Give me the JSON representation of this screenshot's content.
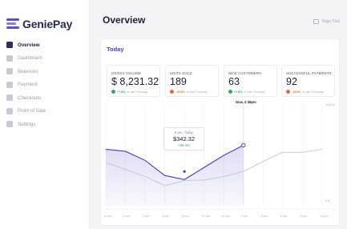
{
  "brand": {
    "name": "GeniePay",
    "accent": "#5d4fc9"
  },
  "sidebar": {
    "items": [
      {
        "label": "Overview",
        "icon": "overview-icon",
        "active": true
      },
      {
        "label": "Dashboard",
        "icon": "dashboard-icon",
        "active": false
      },
      {
        "label": "Balances",
        "icon": "balances-icon",
        "active": false
      },
      {
        "label": "Payment",
        "icon": "payment-icon",
        "active": false
      },
      {
        "label": "Checkouts",
        "icon": "checkouts-icon",
        "active": false
      },
      {
        "label": "Point of Sale",
        "icon": "point-of-sale-icon",
        "active": false
      },
      {
        "label": "Settings",
        "icon": "settings-icon",
        "active": false
      }
    ]
  },
  "header": {
    "title": "Overview",
    "signout_label": "Sign Out"
  },
  "panel": {
    "title": "Today",
    "metrics": [
      {
        "label": "Gross Volume",
        "value": "$ 8,231.32",
        "delta": "+7.8%",
        "delta_sub": "vs last Thursday",
        "positive": true
      },
      {
        "label": "Units Sold",
        "value": "189",
        "delta": "-15.8%",
        "delta_sub": "vs last Thursday",
        "positive": false
      },
      {
        "label": "New Customers",
        "value": "63",
        "delta": "+7.8%",
        "delta_sub": "vs last Thursday",
        "positive": true
      },
      {
        "label": "Successful Payments",
        "value": "92",
        "delta": "-15.8%",
        "delta_sub": "vs last Thursday",
        "positive": false
      }
    ]
  },
  "chart_data": {
    "type": "line",
    "now_label": "Now, 2:38pm",
    "x": [
      "12 am",
      "2 am",
      "4 am",
      "6 am",
      "8 am",
      "10 am",
      "12 pm",
      "2 pm",
      "4 pm",
      "6 pm",
      "8 pm",
      "10 pm"
    ],
    "ylim": [
      0,
      1000
    ],
    "y_tick_labels": [
      "1000 $",
      "0 $"
    ],
    "series": [
      {
        "values": [
          560,
          540,
          450,
          300,
          260,
          380,
          500,
          600
        ]
      },
      {
        "values": [
          430,
          360,
          290,
          200,
          250,
          255,
          290,
          340,
          440,
          530,
          530,
          560
        ]
      }
    ],
    "tooltip": {
      "time": "8 pm, Today",
      "value": "$342.32",
      "delta": "+55.4%"
    },
    "colors": {
      "today": "#4b3fb0",
      "compare": "#c8c8d2",
      "positive": "#3aa66a",
      "negative": "#e0684a"
    }
  }
}
